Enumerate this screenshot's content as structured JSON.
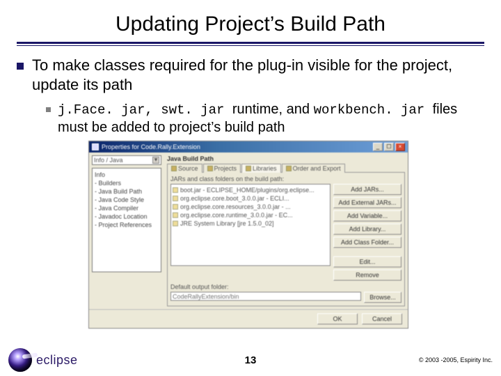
{
  "title": "Updating Project’s Build Path",
  "bullets": {
    "lvl1": "To make classes required for the plug-in visible for the project, update its path",
    "lvl2_pre": "j.Face. jar,  swt. jar ",
    "lvl2_mid": "runtime, and ",
    "lvl2_code": "workbench. jar ",
    "lvl2_post": "files must be added to project’s build path"
  },
  "dialog": {
    "title": "Properties for Code.Rally.Extension",
    "combo": "Info / Java",
    "tree": [
      "Info",
      "- Builders",
      "- Java Build Path",
      "- Java Code Style",
      "- Java Compiler",
      "- Javadoc Location",
      "- Project References"
    ],
    "heading": "Java Build Path",
    "tabs": [
      "Source",
      "Projects",
      "Libraries",
      "Order and Export"
    ],
    "label": "JARs and class folders on the build path:",
    "jars": [
      "boot.jar - ECLIPSE_HOME/plugins/org.eclipse...",
      "org.eclipse.core.boot_3.0.0.jar - ECLI...",
      "org.eclipse.core.resources_3.0.0.jar - ...",
      "org.eclipse.core.runtime_3.0.0.jar - EC...",
      "JRE System Library [jre 1.5.0_02]"
    ],
    "buttons": [
      "Add JARs...",
      "Add External JARs...",
      "Add Variable...",
      "Add Library...",
      "Add Class Folder...",
      "Edit...",
      "Remove"
    ],
    "def_label": "Default output folder:",
    "def_value": "CodeRallyExtension/bin",
    "browse": "Browse...",
    "ok": "OK",
    "cancel": "Cancel"
  },
  "footer": {
    "logo": "eclipse",
    "page": "13",
    "copyright": "© 2003 -2005, Espirity Inc."
  }
}
